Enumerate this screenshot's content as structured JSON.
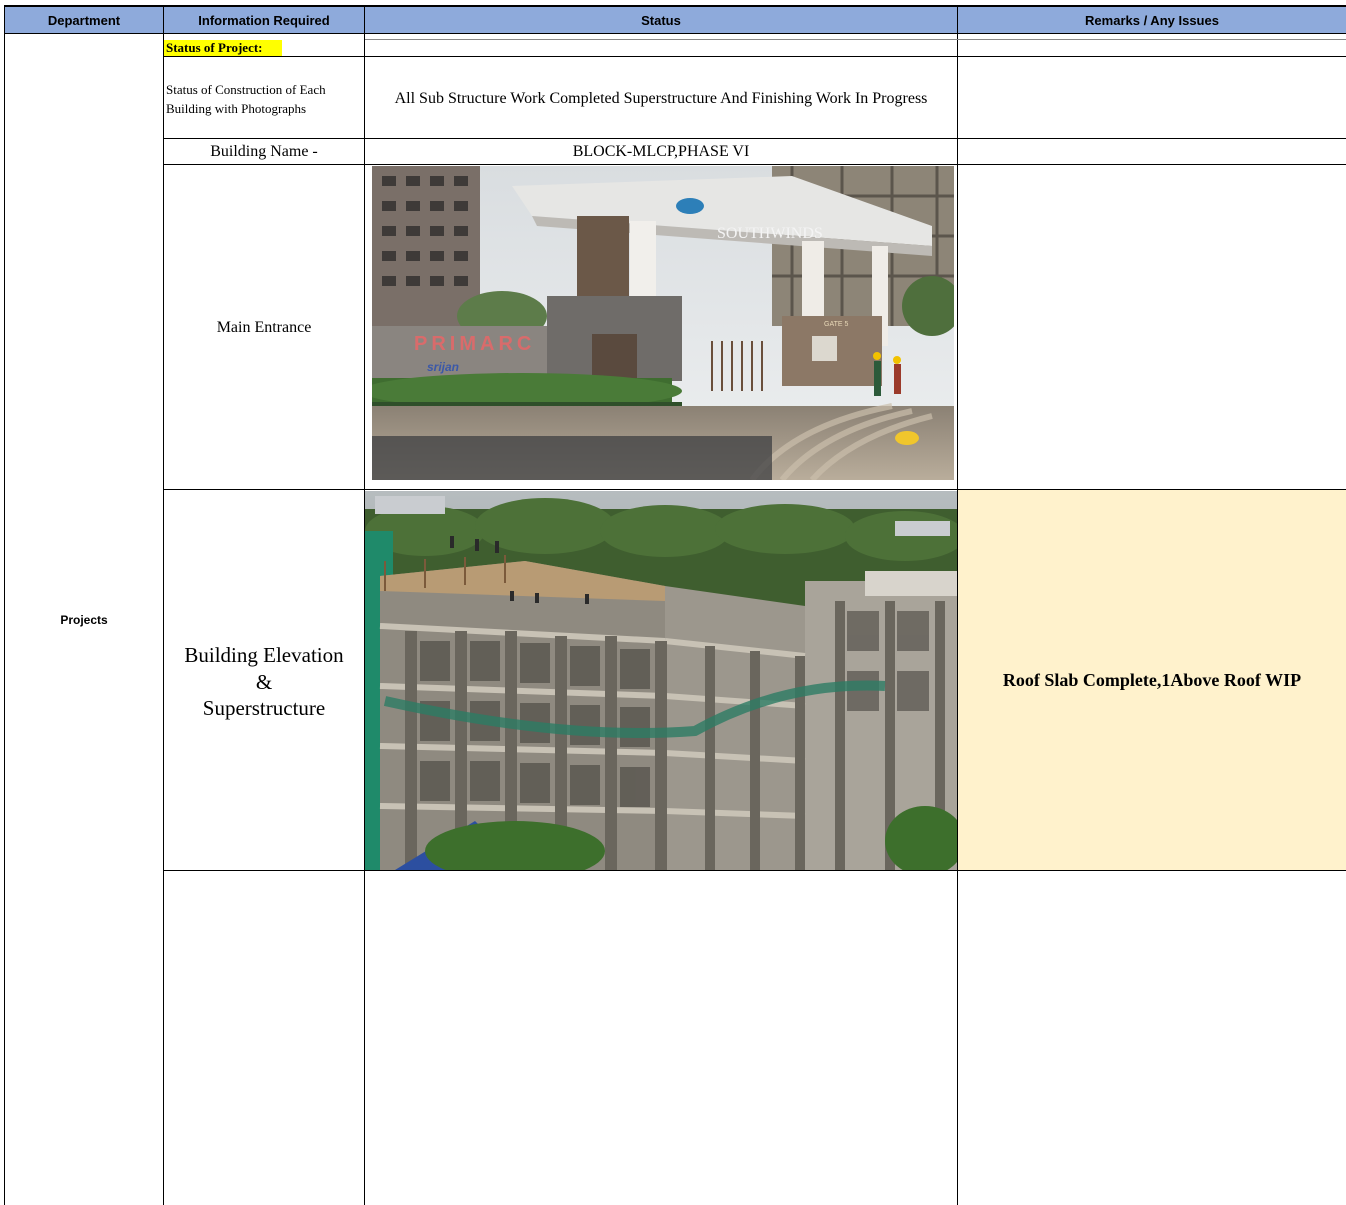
{
  "header": {
    "department": "Department",
    "information_required": "Information Required",
    "status": "Status",
    "remarks": "Remarks / Any Issues"
  },
  "department_value": "Projects",
  "rows": {
    "status_of_project": "Status of Project:",
    "construction_status_label": "Status of Construction of Each Building with Photographs",
    "construction_status_value": "All Sub  Structure Work  Completed Superstructure And Finishing Work In Progress",
    "building_name_label": "Building Name -",
    "building_name_value": "BLOCK-MLCP,PHASE VI",
    "main_entrance_label": "Main Entrance",
    "elevation_label_1": "Building Elevation",
    "elevation_label_2": "&",
    "elevation_label_3": "Superstructure",
    "elevation_remark": "Roof Slab Complete,1Above Roof WIP"
  },
  "photo_text": {
    "primarc": "PRIMARC",
    "southwinds": "SOUTHWINDS",
    "srijan": "srijan",
    "gate": "GATE 5"
  },
  "colors": {
    "header_bg": "#8eaadb",
    "highlight_yellow": "#ffff00",
    "remark_bg": "#fff2cc"
  }
}
